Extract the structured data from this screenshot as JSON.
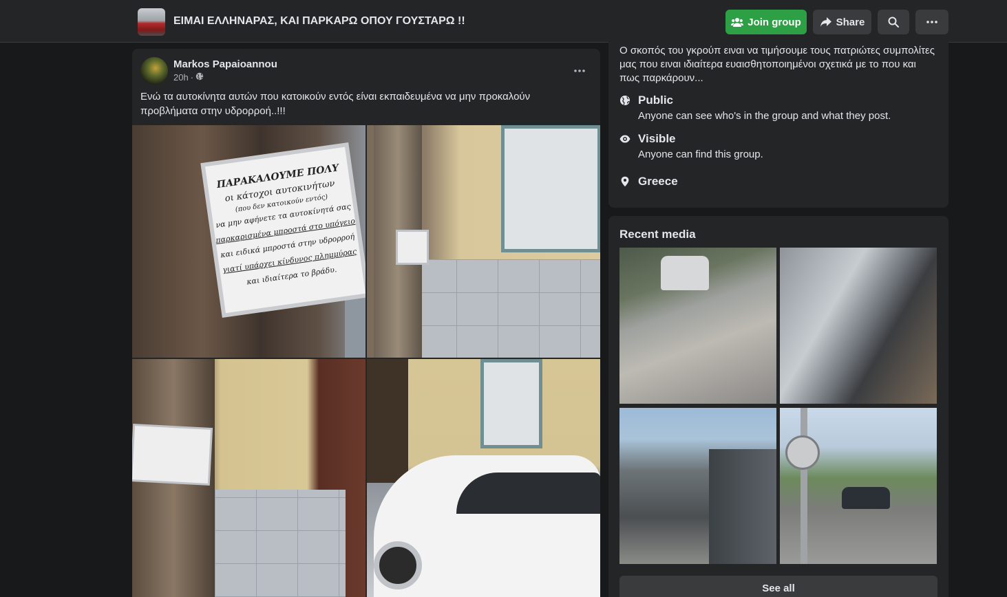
{
  "header": {
    "group_name": "ΕΙΜΑΙ ΕΛΛΗΝΑΡΑΣ, ΚΑΙ ΠΑΡΚΑΡΩ ΟΠΟΥ ΓΟΥΣΤΑΡΩ !!",
    "join_label": "Join group",
    "share_label": "Share",
    "icons": [
      "group-icon",
      "share-arrow-icon",
      "search-icon",
      "more-horizontal-icon"
    ]
  },
  "post": {
    "author": "Markos Papaioannou",
    "time": "20h",
    "separator": "·",
    "privacy_icon": "globe-icon",
    "text": "Ενώ τα αυτοκίνητα αυτών που κατοικούν εντός είναι εκπαιδευμένα να μην προκαλούν προβλήματα στην υδρορροή..!!!",
    "photo_sign": {
      "heading": "ΠΑΡΑΚΑΛΟΥΜΕ ΠΟΛΥ",
      "lines": [
        "οι κάτοχοι αυτοκινήτων",
        "(που δεν κατοικούν εντός)",
        "να μην αφήνετε τα αυτοκίνητά σας",
        "παρκαρισμένα μπροστά στο υπόγειο",
        "και ειδικά μπροστά στην υδρορροή",
        "γιατί υπάρχει κίνδυνος πλημμύρας",
        "και ιδιαίτερα το βράδυ."
      ]
    }
  },
  "about": {
    "description": "Ο σκοπός του γκρούπ ειναι να τιμήσουμε τους πατριώτες συμπολίτες μας που ειναι ιδιαίτερα ευαισθητοποιημένοι σχετικά με το που και πως παρκάρουν...",
    "items": [
      {
        "icon": "globe-icon",
        "title": "Public",
        "desc": "Anyone can see who's in the group and what they post."
      },
      {
        "icon": "eye-icon",
        "title": "Visible",
        "desc": "Anyone can find this group."
      },
      {
        "icon": "location-pin-icon",
        "title": "Greece",
        "desc": ""
      }
    ]
  },
  "recent_media": {
    "title": "Recent media",
    "see_all_label": "See all"
  }
}
